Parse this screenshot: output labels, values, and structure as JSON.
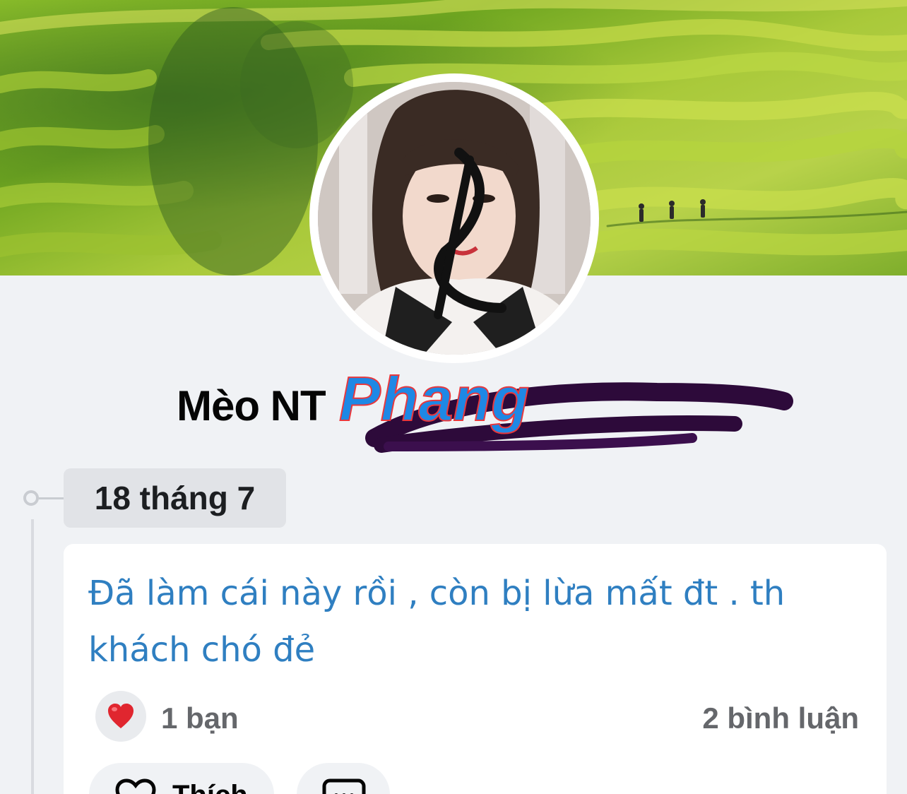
{
  "profile": {
    "name_visible": "Mèo NT"
  },
  "watermark": {
    "text": "Phang",
    "colors": [
      "#e8383d",
      "#1e88e5"
    ]
  },
  "timeline": {
    "date_label": "18 tháng 7"
  },
  "post": {
    "text": "Đã làm cái này rồi , còn bị lừa mất đt . th khách chó đẻ",
    "text_color": "#2f7fc1",
    "reaction_icon": "heart-icon",
    "reaction_count": "1 bạn",
    "comment_count": "2 bình luận"
  },
  "actions": {
    "like_label": "Thích",
    "like_icon": "heart-outline-icon",
    "comment_icon": "comment-icon"
  }
}
